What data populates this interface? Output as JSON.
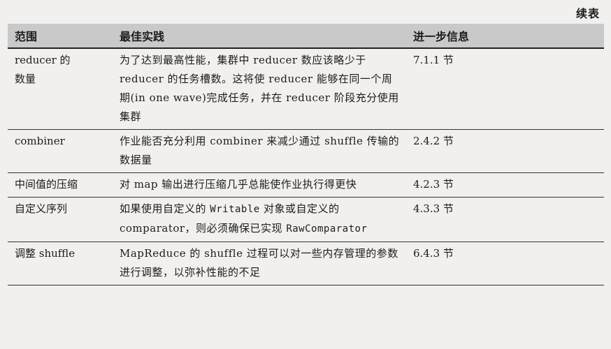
{
  "continued_label": "续表",
  "headers": {
    "scope": "范围",
    "practice": "最佳实践",
    "info": "进一步信息"
  },
  "rows": [
    {
      "scope_lines": [
        "reducer 的",
        "数量"
      ],
      "practice_parts": [
        {
          "text": "为了达到最高性能，集群中 reducer 数应该略少于 reducer 的任务槽数。这将使 reducer 能够在同一个周期(in one wave)完成任务，并在 reducer 阶段充分使用集群",
          "mono": false
        }
      ],
      "info": "7.1.1 节"
    },
    {
      "scope_lines": [
        "combiner"
      ],
      "practice_parts": [
        {
          "text": "作业能否充分利用 combiner 来减少通过 shuffle 传输的数据量",
          "mono": false
        }
      ],
      "info": "2.4.2 节"
    },
    {
      "scope_lines": [
        "中间值的压缩"
      ],
      "practice_parts": [
        {
          "text": "对 map 输出进行压缩几乎总能使作业执行得更快",
          "mono": false
        }
      ],
      "info": "4.2.3 节"
    },
    {
      "scope_lines": [
        "自定义序列"
      ],
      "practice_parts": [
        {
          "text": "如果使用自定义的 ",
          "mono": false
        },
        {
          "text": "Writable",
          "mono": true
        },
        {
          "text": " 对象或自定义的 comparator，则必须确保已实现 ",
          "mono": false
        },
        {
          "text": "RawComparator",
          "mono": true
        }
      ],
      "info": "4.3.3 节"
    },
    {
      "scope_lines": [
        "调整 shuffle"
      ],
      "practice_parts": [
        {
          "text": "MapReduce 的 shuffle 过程可以对一些内存管理的参数进行调整，以弥补性能的不足",
          "mono": false
        }
      ],
      "info": "6.4.3 节"
    }
  ]
}
